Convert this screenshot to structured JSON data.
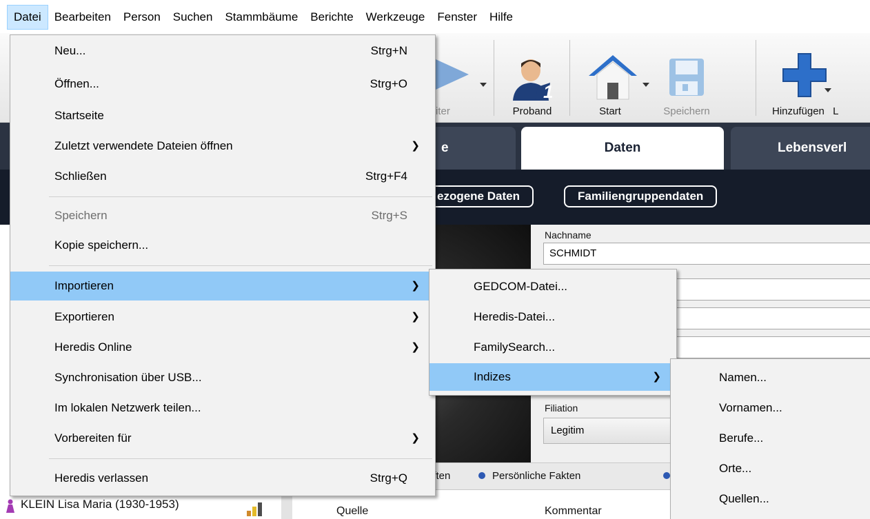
{
  "menubar": {
    "items": [
      "Datei",
      "Bearbeiten",
      "Person",
      "Suchen",
      "Stammbäume",
      "Berichte",
      "Werkzeuge",
      "Fenster",
      "Hilfe"
    ]
  },
  "toolbar": {
    "partial_label": "iter",
    "proband_label": "Proband",
    "start_label": "Start",
    "save_label": "Speichern",
    "add_label": "Hinzufügen",
    "cut_label": "L"
  },
  "tabs": {
    "left_partial": "e",
    "active": "Daten",
    "right": "Lebensverl"
  },
  "subtabs": {
    "left_partial": "ezogene Daten",
    "family": "Familiengruppendaten"
  },
  "form": {
    "surname_label": "Nachname",
    "surname_value": "SCHMIDT",
    "filiation_label": "Filiation",
    "filiation_value": "Legitim"
  },
  "facts_tabs": {
    "partial": "aften",
    "personal": "Persönliche Fakten"
  },
  "bottom": {
    "source_header": "Quelle",
    "comment_header": "Kommentar"
  },
  "person_row": {
    "name": "KLEIN Lisa Maria (1930-1953)"
  },
  "file_menu": {
    "items": [
      {
        "label": "Neu...",
        "shortcut": "Strg+N"
      },
      {
        "label": "Öffnen...",
        "shortcut": "Strg+O"
      },
      {
        "label": "Startseite",
        "shortcut": ""
      },
      {
        "label": "Zuletzt verwendete Dateien öffnen",
        "shortcut": ""
      },
      {
        "label": "Schließen",
        "shortcut": "Strg+F4"
      },
      {
        "label": "Speichern",
        "shortcut": "Strg+S"
      },
      {
        "label": "Kopie speichern...",
        "shortcut": ""
      },
      {
        "label": "Importieren",
        "shortcut": ""
      },
      {
        "label": "Exportieren",
        "shortcut": ""
      },
      {
        "label": "Heredis Online",
        "shortcut": ""
      },
      {
        "label": "Synchronisation über USB...",
        "shortcut": ""
      },
      {
        "label": "Im lokalen Netzwerk teilen...",
        "shortcut": ""
      },
      {
        "label": "Vorbereiten für",
        "shortcut": ""
      },
      {
        "label": "Heredis verlassen",
        "shortcut": "Strg+Q"
      }
    ]
  },
  "import_menu": {
    "items": [
      "GEDCOM-Datei...",
      "Heredis-Datei...",
      "FamilySearch...",
      "Indizes"
    ]
  },
  "indizes_menu": {
    "items": [
      "Namen...",
      "Vornamen...",
      "Berufe...",
      "Orte...",
      "Quellen..."
    ]
  },
  "colors": {
    "menu_highlight": "#91c9f7",
    "tab_bar": "#2b3342",
    "subbar": "#151c2a",
    "brand_blue": "#2d6fc9"
  }
}
